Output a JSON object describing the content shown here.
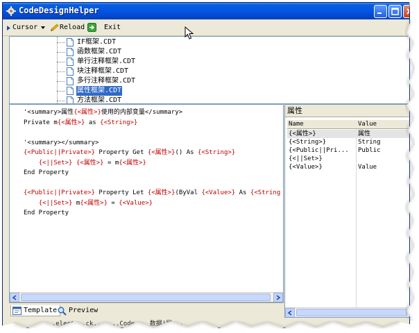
{
  "window": {
    "title": "CodeDesignHelper"
  },
  "toolbar": {
    "cursor_label": "Cursor",
    "reload_label": "Reload",
    "exit_label": "Exit"
  },
  "tree": {
    "items": [
      {
        "label": "IF框架.CDT",
        "selected": false
      },
      {
        "label": "函数框架.CDT",
        "selected": false
      },
      {
        "label": "单行注释框架.CDT",
        "selected": false
      },
      {
        "label": "块注释框架.CDT",
        "selected": false
      },
      {
        "label": "多行注释框架.CDT",
        "selected": false
      },
      {
        "label": "属性框架.CDT",
        "selected": true
      },
      {
        "label": "方法框架.CDT",
        "selected": false
      }
    ]
  },
  "editor": {
    "lines": [
      [
        {
          "t": "'<summary>属性",
          "c": ""
        },
        {
          "t": "{<属性>}",
          "c": "red"
        },
        {
          "t": "使用的内部变量</summary>",
          "c": ""
        }
      ],
      [
        {
          "t": "Private m",
          "c": ""
        },
        {
          "t": "{<属性>}",
          "c": "red"
        },
        {
          "t": " as ",
          "c": ""
        },
        {
          "t": "{<String>}",
          "c": "red"
        }
      ],
      [],
      [
        {
          "t": "'<summary></summary>",
          "c": ""
        }
      ],
      [
        {
          "t": "{<Public||Private>}",
          "c": "red"
        },
        {
          "t": " Property Get ",
          "c": ""
        },
        {
          "t": "{<属性>}",
          "c": "red"
        },
        {
          "t": "() As ",
          "c": ""
        },
        {
          "t": "{<String>}",
          "c": "red"
        }
      ],
      [
        {
          "t": "    ",
          "c": ""
        },
        {
          "t": "{<||Set>}",
          "c": "red"
        },
        {
          "t": " ",
          "c": ""
        },
        {
          "t": "{<属性>}",
          "c": "red"
        },
        {
          "t": " = m",
          "c": ""
        },
        {
          "t": "{<属性>}",
          "c": "red"
        }
      ],
      [
        {
          "t": "End Property",
          "c": ""
        }
      ],
      [],
      [
        {
          "t": "{<Public||Private>}",
          "c": "red"
        },
        {
          "t": " Property Let ",
          "c": ""
        },
        {
          "t": "{<属性>}",
          "c": "red"
        },
        {
          "t": "(ByVal ",
          "c": ""
        },
        {
          "t": "{<Value>}",
          "c": "red"
        },
        {
          "t": " As ",
          "c": ""
        },
        {
          "t": "{<String",
          "c": "red"
        }
      ],
      [
        {
          "t": "    ",
          "c": ""
        },
        {
          "t": "{<||Set>}",
          "c": "red"
        },
        {
          "t": " m",
          "c": ""
        },
        {
          "t": "{<属性>}",
          "c": "red"
        },
        {
          "t": " = ",
          "c": ""
        },
        {
          "t": "{<Value>}",
          "c": "red"
        }
      ],
      [
        {
          "t": "End Property",
          "c": ""
        }
      ]
    ]
  },
  "tabs": [
    {
      "label": "Template",
      "active": true
    },
    {
      "label": "Preview",
      "active": false
    }
  ],
  "properties": {
    "title": "属性",
    "columns": {
      "name": "Name",
      "value": "Value"
    },
    "rows": [
      {
        "name": "{<属性>}",
        "value": "属性",
        "selected": true
      },
      {
        "name": "{<String>}",
        "value": "String",
        "selected": false
      },
      {
        "name": "{<Public||Pri...",
        "value": "Public",
        "selected": false
      },
      {
        "name": "{<||Set>}",
        "value": "",
        "selected": false
      },
      {
        "name": "{<Value>}",
        "value": "Value",
        "selected": false
      }
    ]
  },
  "status": {
    "text": "...elect...ck...  ...Code...  数据|属..."
  },
  "colors": {
    "template_red": "#c00000",
    "selection_blue": "#316ac5",
    "titlebar_blue": "#0554e3"
  }
}
